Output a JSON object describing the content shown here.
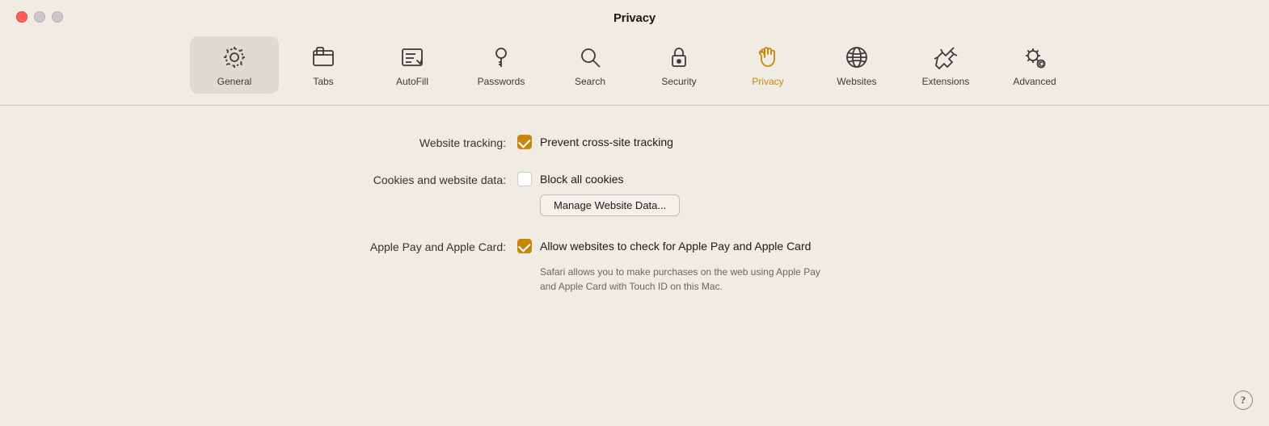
{
  "window": {
    "title": "Privacy"
  },
  "toolbar": {
    "items": [
      {
        "id": "general",
        "label": "General",
        "active": true,
        "activeStyle": "box"
      },
      {
        "id": "tabs",
        "label": "Tabs",
        "active": false
      },
      {
        "id": "autofill",
        "label": "AutoFill",
        "active": false
      },
      {
        "id": "passwords",
        "label": "Passwords",
        "active": false
      },
      {
        "id": "search",
        "label": "Search",
        "active": false
      },
      {
        "id": "security",
        "label": "Security",
        "active": false
      },
      {
        "id": "privacy",
        "label": "Privacy",
        "active": true,
        "selected": true
      },
      {
        "id": "websites",
        "label": "Websites",
        "active": false
      },
      {
        "id": "extensions",
        "label": "Extensions",
        "active": false
      },
      {
        "id": "advanced",
        "label": "Advanced",
        "active": false
      }
    ]
  },
  "settings": {
    "website_tracking": {
      "label": "Website tracking:",
      "checkbox_label": "Prevent cross-site tracking",
      "checked": true
    },
    "cookies": {
      "label": "Cookies and website data:",
      "checkbox_label": "Block all cookies",
      "checked": false,
      "button_label": "Manage Website Data..."
    },
    "apple_pay": {
      "label": "Apple Pay and Apple Card:",
      "checkbox_label": "Allow websites to check for Apple Pay and Apple Card",
      "checked": true,
      "sublabel": "Safari allows you to make purchases on the web using Apple Pay\nand Apple Card with Touch ID on this Mac."
    }
  },
  "help": "?"
}
